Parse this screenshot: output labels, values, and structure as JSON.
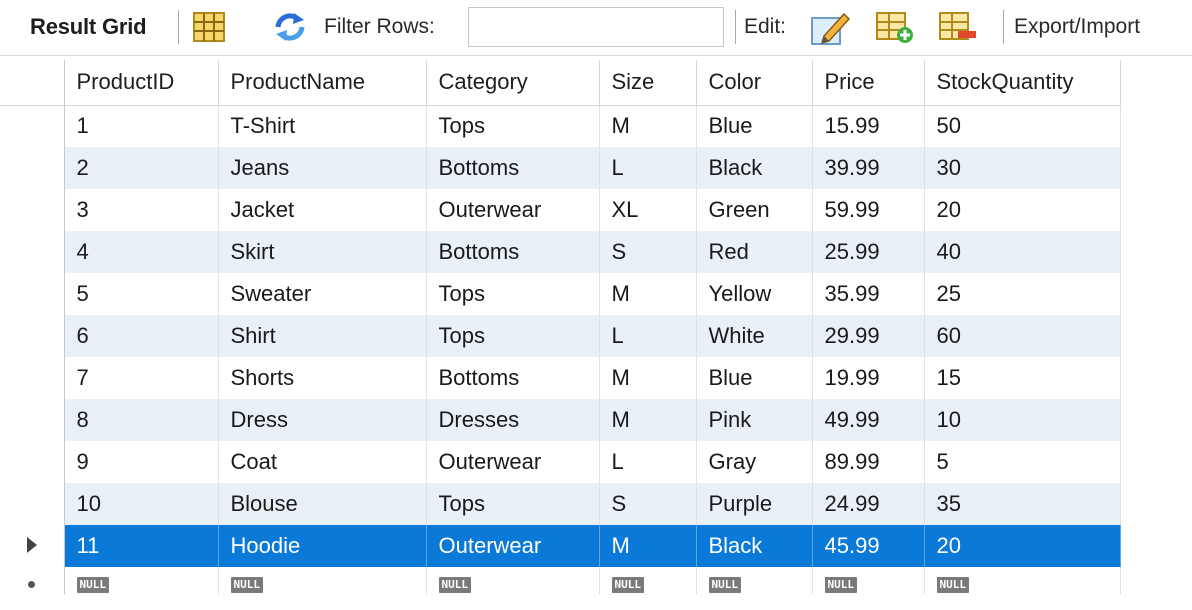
{
  "toolbar": {
    "title": "Result Grid",
    "filter_label": "Filter Rows:",
    "filter_value": "",
    "edit_label": "Edit:",
    "export_label": "Export/Import"
  },
  "icons": {
    "grid_layout": "grid-layout-icon",
    "refresh": "refresh-icon",
    "edit_cell": "edit-cell-icon",
    "add_row": "add-row-icon",
    "delete_row": "delete-row-icon"
  },
  "colors": {
    "selected_row": "#0a79d8",
    "alt_row": "#eaf0f8",
    "null_badge": "#7a7a7a"
  },
  "columns": [
    "ProductID",
    "ProductName",
    "Category",
    "Size",
    "Color",
    "Price",
    "StockQuantity"
  ],
  "rows": [
    [
      "1",
      "T-Shirt",
      "Tops",
      "M",
      "Blue",
      "15.99",
      "50"
    ],
    [
      "2",
      "Jeans",
      "Bottoms",
      "L",
      "Black",
      "39.99",
      "30"
    ],
    [
      "3",
      "Jacket",
      "Outerwear",
      "XL",
      "Green",
      "59.99",
      "20"
    ],
    [
      "4",
      "Skirt",
      "Bottoms",
      "S",
      "Red",
      "25.99",
      "40"
    ],
    [
      "5",
      "Sweater",
      "Tops",
      "M",
      "Yellow",
      "35.99",
      "25"
    ],
    [
      "6",
      "Shirt",
      "Tops",
      "L",
      "White",
      "29.99",
      "60"
    ],
    [
      "7",
      "Shorts",
      "Bottoms",
      "M",
      "Blue",
      "19.99",
      "15"
    ],
    [
      "8",
      "Dress",
      "Dresses",
      "M",
      "Pink",
      "49.99",
      "10"
    ],
    [
      "9",
      "Coat",
      "Outerwear",
      "L",
      "Gray",
      "89.99",
      "5"
    ],
    [
      "10",
      "Blouse",
      "Tops",
      "S",
      "Purple",
      "24.99",
      "35"
    ],
    [
      "11",
      "Hoodie",
      "Outerwear",
      "M",
      "Black",
      "45.99",
      "20"
    ]
  ],
  "selected_row_index": 10,
  "new_row_placeholder": "NULL"
}
